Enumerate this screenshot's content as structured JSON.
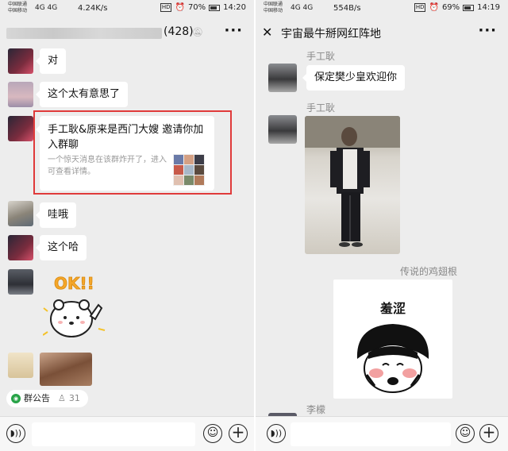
{
  "left": {
    "status": {
      "carrier1": "中国联通",
      "carrier2": "中国移动",
      "net": "4G 4G",
      "speed": "4.24K/s",
      "hd": "HD",
      "battery": "70%",
      "time": "14:20"
    },
    "header": {
      "title_suffix": "(428)",
      "more": "···"
    },
    "messages": [
      {
        "text": "对"
      },
      {
        "text": "这个太有意思了"
      },
      {
        "text": "哇哦"
      },
      {
        "text": "这个哈"
      }
    ],
    "invite": {
      "title": "手工耿&原来是西门大嫂 邀请你加入群聊",
      "desc": "一个惊天消息在该群炸开了，进入可查看详情。"
    },
    "sticker_text": "OK!!",
    "notice": {
      "label": "群公告",
      "count": "31"
    }
  },
  "right": {
    "status": {
      "carrier1": "中国联通",
      "carrier2": "中国移动",
      "net": "4G 4G",
      "speed": "554B/s",
      "hd": "HD",
      "battery": "69%",
      "time": "14:19"
    },
    "header": {
      "title": "宇宙最牛掰网红阵地",
      "close": "✕",
      "more": "···"
    },
    "messages": [
      {
        "sender": "手工耿",
        "text": "保定樊少皇欢迎你"
      },
      {
        "sender": "手工耿"
      },
      {
        "sender": "传说的鸡翅根",
        "sticker_text": "羞涩"
      },
      {
        "sender": "李檬"
      }
    ]
  },
  "colors": {
    "background": "#ededed",
    "bubble": "#ffffff",
    "highlight_border": "#e03a3a",
    "notice_dot": "#27a347"
  }
}
